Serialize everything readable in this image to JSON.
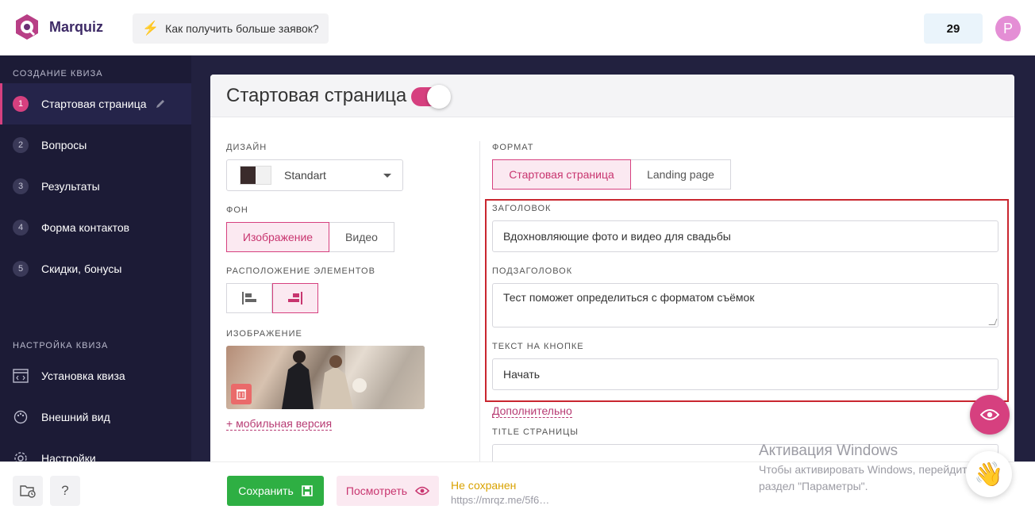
{
  "header": {
    "logo_text": "Marquiz",
    "tip_label": "Как получить больше заявок?",
    "counter": "29",
    "avatar_letter": "P"
  },
  "sidebar": {
    "section_create": "СОЗДАНИЕ КВИЗА",
    "steps": [
      {
        "num": "1",
        "label": "Стартовая страница"
      },
      {
        "num": "2",
        "label": "Вопросы"
      },
      {
        "num": "3",
        "label": "Результаты"
      },
      {
        "num": "4",
        "label": "Форма контактов"
      },
      {
        "num": "5",
        "label": "Скидки, бонусы"
      }
    ],
    "section_settings": "НАСТРОЙКА КВИЗА",
    "settings": [
      {
        "label": "Установка квиза"
      },
      {
        "label": "Внешний вид"
      },
      {
        "label": "Настройки"
      }
    ]
  },
  "panel": {
    "title": "Стартовая страница",
    "design_label": "ДИЗАЙН",
    "design_value": "Standart",
    "bg_label": "ФОН",
    "bg_options": [
      "Изображение",
      "Видео"
    ],
    "layout_label": "РАСПОЛОЖЕНИЕ ЭЛЕМЕНТОВ",
    "image_label": "ИЗОБРАЖЕНИЕ",
    "mobile_link": "+ мобильная версия",
    "format_label": "ФОРМАТ",
    "format_options": [
      "Стартовая страница",
      "Landing page"
    ],
    "heading_label": "ЗАГОЛОВОК",
    "heading_value": "Вдохновляющие фото и видео для свадьбы",
    "subheading_label": "ПОДЗАГОЛОВОК",
    "subheading_value": "Тест поможет определиться с форматом съёмок",
    "button_text_label": "ТЕКСТ НА КНОПКЕ",
    "button_text_value": "Начать",
    "more_link": "Дополнительно",
    "page_title_label": "TITLE СТРАНИЦЫ"
  },
  "footer": {
    "save_label": "Сохранить",
    "view_label": "Посмотреть",
    "status": "Не сохранен",
    "url": "https://mrqz.me/5f6…",
    "help": "?"
  },
  "watermark": {
    "line1": "Активация Windows",
    "line2": "Чтобы активировать Windows, перейдите в",
    "line3": "раздел \"Параметры\"."
  },
  "colors": {
    "accent": "#d6407f",
    "sidebar_bg": "#1c1b36",
    "save_green": "#2eaf43",
    "highlight_red": "#c9262f"
  }
}
